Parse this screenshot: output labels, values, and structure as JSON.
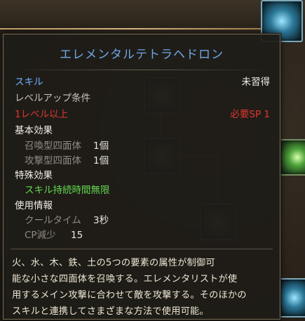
{
  "tooltip": {
    "title": "エレメンタルテトラヘドロン",
    "category": "スキル",
    "learn_status": "未習得",
    "level_req_header": "レベルアップ条件",
    "level_req": "1レベル以上",
    "sp_required": "必要SP 1",
    "basic_effect_header": "基本効果",
    "basic_effects": [
      {
        "name": "召喚型四面体",
        "value": "1個"
      },
      {
        "name": "攻撃型四面体",
        "value": "1個"
      }
    ],
    "special_effect_header": "特殊効果",
    "special_effect": "スキル持続時間無限",
    "usage_header": "使用情報",
    "usage": [
      {
        "name": "クールタイム",
        "value": "3秒"
      },
      {
        "name": "CP減少",
        "value": "15"
      }
    ],
    "description_lines": [
      "火、水、木、鉄、土の5つの要素の属性が制御可",
      "能な小さな四面体を召喚する。エレメンタリストが使",
      "用するメイン攻撃に合わせて敵を攻撃する。そのほかの",
      "スキルと連携してさまざまな方法で使用可能。"
    ]
  },
  "colors": {
    "title": "#6fa6e6",
    "category": "#6fb0ff",
    "requirement_unmet": "#e0362f",
    "special_effect": "#62d94e",
    "panel_border": "#7a6d57"
  },
  "background_icons": [
    "tetrahedron-skill-icon",
    "green-skill-icon",
    "teal-skill-icon"
  ]
}
